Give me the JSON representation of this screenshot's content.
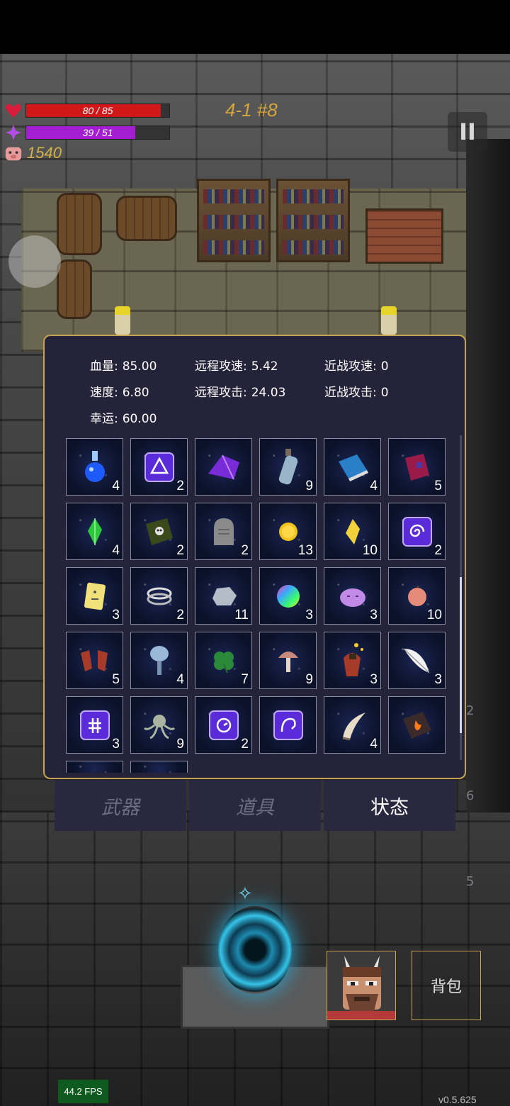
{
  "hud": {
    "hp": {
      "current": 80,
      "max": 85,
      "text": "80 / 85",
      "color": "#d01818"
    },
    "mp": {
      "current": 39,
      "max": 51,
      "text": "39 / 51",
      "color": "#a21ed0"
    },
    "gold": "1540",
    "level": "4-1 #8",
    "pause_icon": "II"
  },
  "stats": [
    {
      "label": "血量:",
      "value": "85.00"
    },
    {
      "label": "远程攻速:",
      "value": "5.42"
    },
    {
      "label": "近战攻速:",
      "value": "0"
    },
    {
      "label": "速度:",
      "value": "6.80"
    },
    {
      "label": "远程攻击:",
      "value": "24.03"
    },
    {
      "label": "近战攻击:",
      "value": "0"
    },
    {
      "label": "幸运:",
      "value": "60.00"
    }
  ],
  "items": [
    {
      "icon": "blue-potion-icon",
      "count": "4"
    },
    {
      "icon": "triangle-rune-icon",
      "count": "2"
    },
    {
      "icon": "purple-shell-icon",
      "count": ""
    },
    {
      "icon": "bottle-icon",
      "count": "9"
    },
    {
      "icon": "blue-book-icon",
      "count": "4"
    },
    {
      "icon": "red-book-icon",
      "count": "5"
    },
    {
      "icon": "green-crystal-icon",
      "count": "4"
    },
    {
      "icon": "skull-book-icon",
      "count": "2"
    },
    {
      "icon": "tombstone-icon",
      "count": "2"
    },
    {
      "icon": "gold-coin-icon",
      "count": "13"
    },
    {
      "icon": "yellow-crystal-icon",
      "count": "10"
    },
    {
      "icon": "spiral-rune-icon",
      "count": "2"
    },
    {
      "icon": "yellow-card-icon",
      "count": "3"
    },
    {
      "icon": "silver-rings-icon",
      "count": "2"
    },
    {
      "icon": "rock-icon",
      "count": "11"
    },
    {
      "icon": "rainbow-orb-icon",
      "count": "3"
    },
    {
      "icon": "purple-slime-icon",
      "count": "3"
    },
    {
      "icon": "peach-icon",
      "count": "10"
    },
    {
      "icon": "red-gloves-icon",
      "count": "5"
    },
    {
      "icon": "hand-mirror-icon",
      "count": "4"
    },
    {
      "icon": "clover-icon",
      "count": "7"
    },
    {
      "icon": "mushroom-icon",
      "count": "9"
    },
    {
      "icon": "heart-bomb-icon",
      "count": "3"
    },
    {
      "icon": "feather-icon",
      "count": "3"
    },
    {
      "icon": "cross-rune-icon",
      "count": "3"
    },
    {
      "icon": "octopus-icon",
      "count": "9"
    },
    {
      "icon": "swirl-rune-icon",
      "count": "2"
    },
    {
      "icon": "hook-rune-icon",
      "count": ""
    },
    {
      "icon": "horn-icon",
      "count": "4"
    },
    {
      "icon": "flame-book-icon",
      "count": ""
    },
    {
      "icon": "partial-slot-icon",
      "count": ""
    },
    {
      "icon": "partial-slot-icon",
      "count": ""
    }
  ],
  "tabs": [
    {
      "label": "武器",
      "active": false
    },
    {
      "label": "道具",
      "active": false
    },
    {
      "label": "状态",
      "active": true
    }
  ],
  "bag_button": "背包",
  "fps": "44.2 FPS",
  "version": "v0.5.625",
  "side_counts": [
    "2",
    "6",
    "5"
  ]
}
